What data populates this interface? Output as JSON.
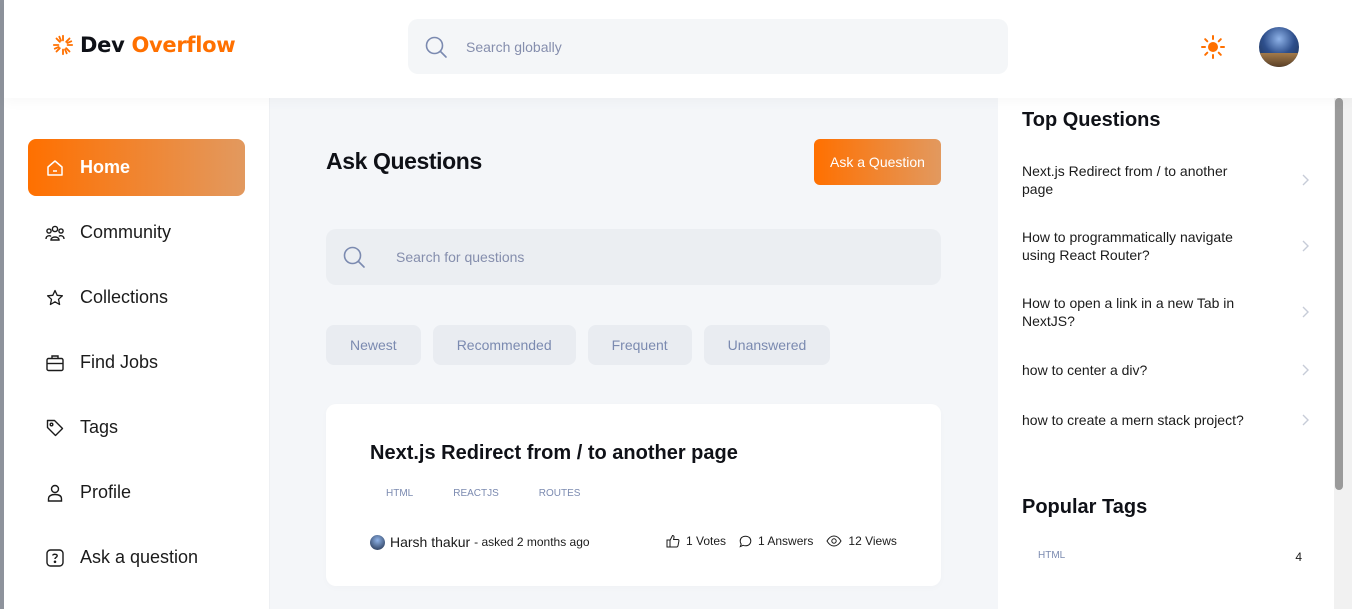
{
  "brand": {
    "name_part1": "Dev",
    "name_part2": "Overflow",
    "accent": "#ff7000"
  },
  "header": {
    "global_search_placeholder": "Search globally",
    "theme_icon": "sun-icon",
    "avatar": "user-avatar"
  },
  "sidebar": {
    "items": [
      {
        "label": "Home",
        "icon": "home-icon",
        "active": true
      },
      {
        "label": "Community",
        "icon": "users-icon"
      },
      {
        "label": "Collections",
        "icon": "star-icon"
      },
      {
        "label": "Find Jobs",
        "icon": "briefcase-icon"
      },
      {
        "label": "Tags",
        "icon": "tag-icon"
      },
      {
        "label": "Profile",
        "icon": "user-icon"
      },
      {
        "label": "Ask a question",
        "icon": "question-icon"
      }
    ]
  },
  "main": {
    "title": "Ask Questions",
    "ask_button": "Ask a Question",
    "search_placeholder": "Search for questions",
    "filters": [
      "Newest",
      "Recommended",
      "Frequent",
      "Unanswered"
    ],
    "questions": [
      {
        "title": "Next.js Redirect from / to another page",
        "tags": [
          "HTML",
          "REACTJS",
          "ROUTES"
        ],
        "author": "Harsh thakur",
        "asked": "- asked 2 months ago",
        "votes": "1 Votes",
        "answers": "1 Answers",
        "views": "12 Views"
      }
    ]
  },
  "right": {
    "top_questions_title": "Top Questions",
    "top_questions": [
      "Next.js Redirect from / to another page",
      "How to programmatically navigate using React Router?",
      "How to open a link in a new Tab in NextJS?",
      "how to center a div?",
      "how to create a mern stack project?"
    ],
    "popular_tags_title": "Popular Tags",
    "popular_tags": [
      {
        "name": "HTML",
        "count": "4"
      }
    ]
  }
}
